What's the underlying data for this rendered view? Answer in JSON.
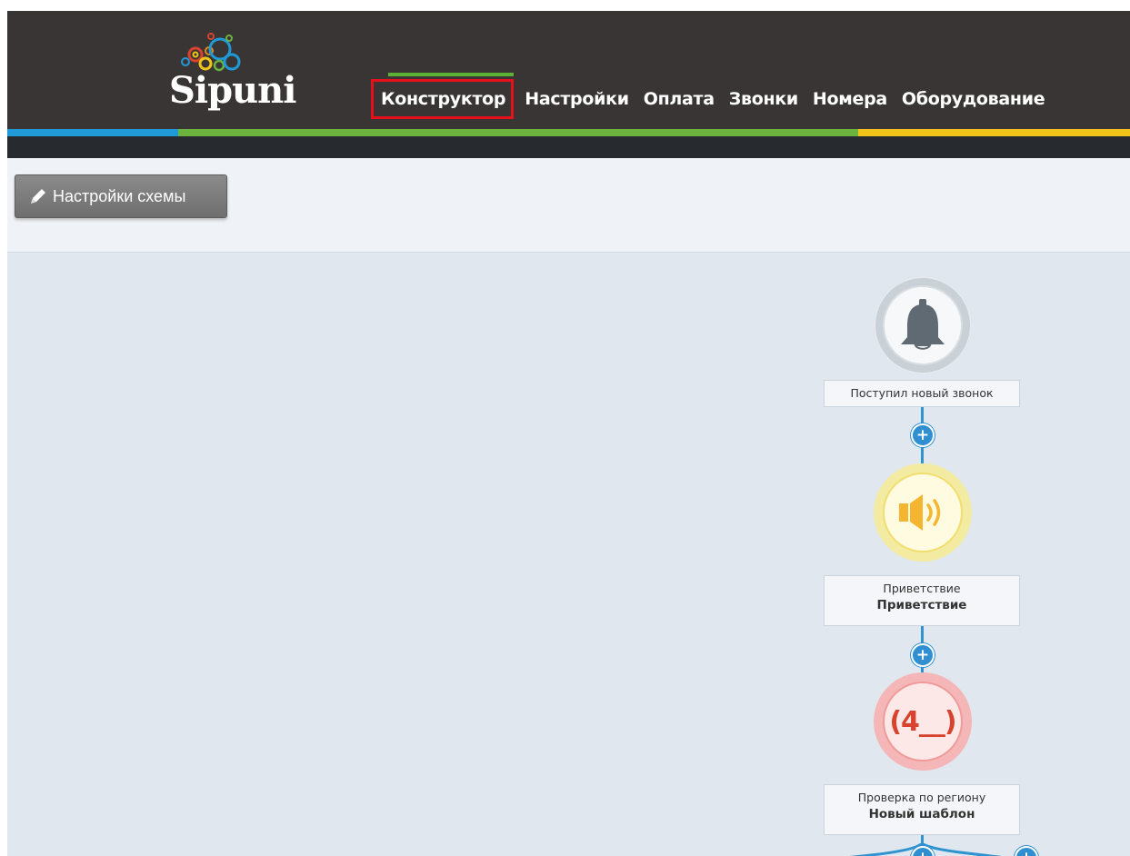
{
  "brand": {
    "name": "Sipuni"
  },
  "nav": {
    "items": [
      {
        "label": "Конструктор",
        "active": true
      },
      {
        "label": "Настройки"
      },
      {
        "label": "Оплата"
      },
      {
        "label": "Звонки"
      },
      {
        "label": "Номера"
      },
      {
        "label": "Оборудование"
      }
    ]
  },
  "toolbar": {
    "scheme_settings_label": "Настройки схемы"
  },
  "flow": {
    "nodes": [
      {
        "icon": "bell-icon",
        "title": "Поступил новый звонок",
        "subtitle": ""
      },
      {
        "icon": "speaker-icon",
        "title": "Приветствие",
        "subtitle": "Приветствие"
      },
      {
        "icon": "region-code-icon",
        "icon_text": "(4__)",
        "title": "Проверка по региону",
        "subtitle": "Новый шаблон"
      }
    ],
    "add_step_symbol": "+"
  },
  "colors": {
    "header_bg": "#3a3535",
    "stripe_blue": "#1f9ad6",
    "stripe_green": "#6cb33e",
    "stripe_yellow": "#f0c419",
    "active_highlight": "#e8111b",
    "connector_blue": "#2f93cf",
    "canvas_bg": "#e0e7ef"
  }
}
